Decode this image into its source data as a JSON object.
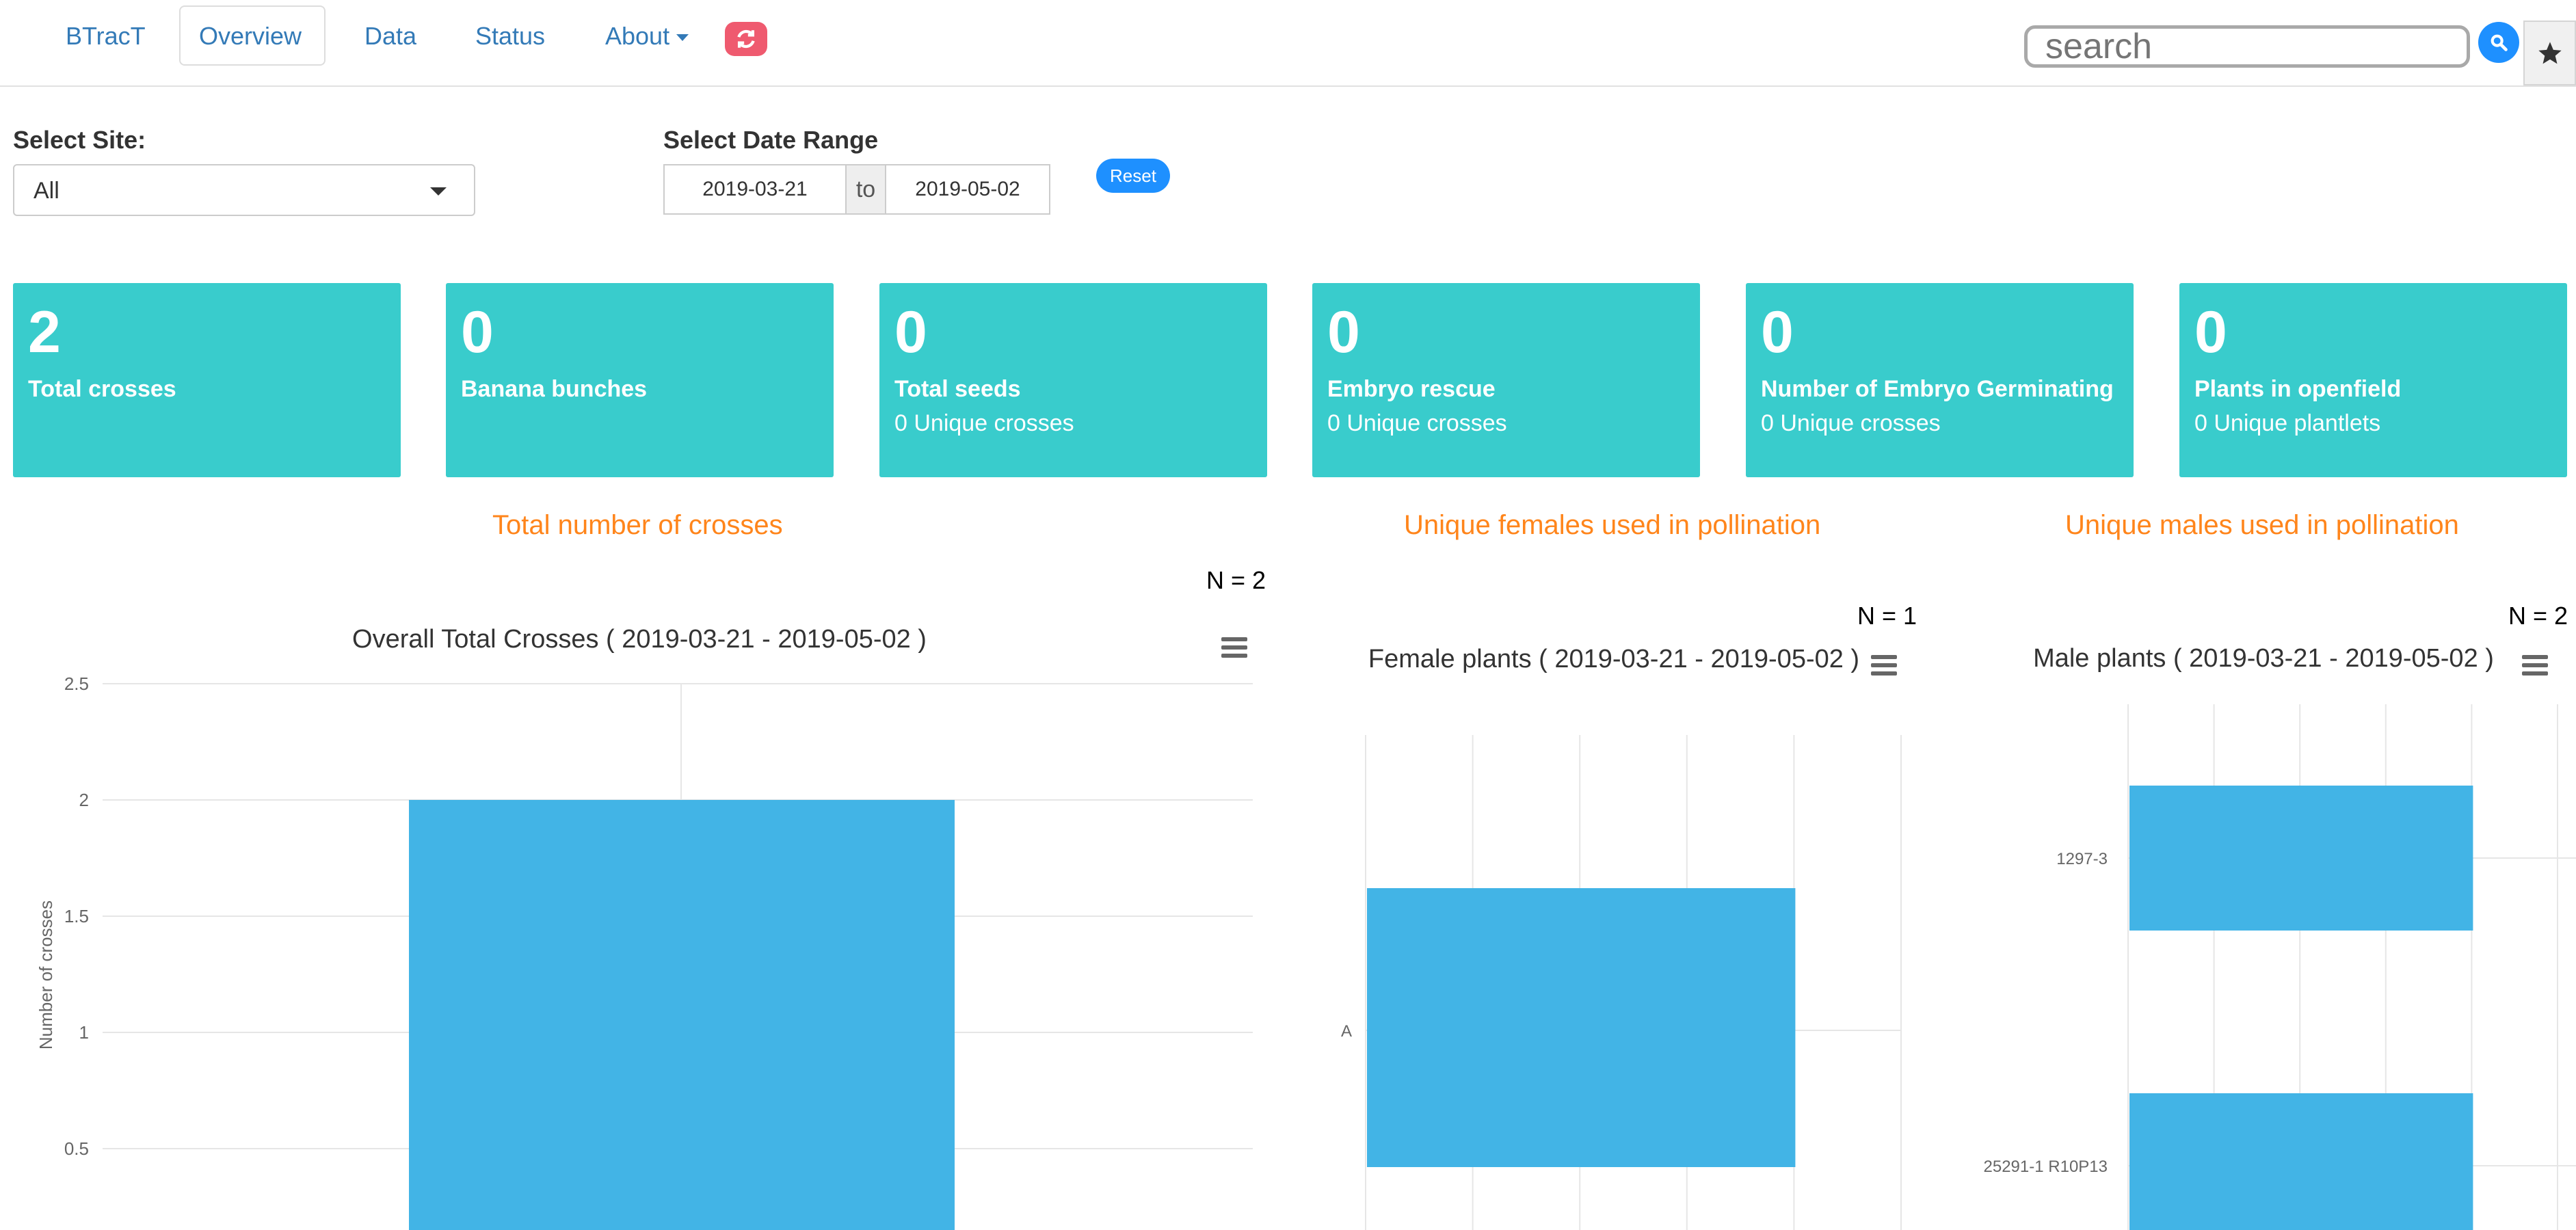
{
  "navbar": {
    "brand": "BTracT",
    "items": [
      "Overview",
      "Data",
      "Status",
      "About"
    ],
    "search": {
      "placeholder": "search"
    }
  },
  "filters": {
    "site_label": "Select Site:",
    "site_value": "All",
    "date_label": "Select Date Range",
    "date_from": "2019-03-21",
    "date_to_sep": "to",
    "date_to": "2019-05-02",
    "reset_label": "Reset"
  },
  "value_boxes": [
    {
      "value": "2",
      "label": "Total crosses",
      "sub": ""
    },
    {
      "value": "0",
      "label": "Banana bunches",
      "sub": ""
    },
    {
      "value": "0",
      "label": "Total seeds",
      "sub": "0 Unique crosses"
    },
    {
      "value": "0",
      "label": "Embryo rescue",
      "sub": "0 Unique crosses"
    },
    {
      "value": "0",
      "label": "Number of Embryo Germinating",
      "sub": "0 Unique crosses"
    },
    {
      "value": "0",
      "label": "Plants in openfield",
      "sub": "0 Unique plantlets"
    }
  ],
  "sections": {
    "crosses_title": "Total number of crosses",
    "females_title": "Unique females used in pollination",
    "males_title": "Unique males used in pollination",
    "crosses_n": "N = 2",
    "females_n": "N = 1",
    "males_n": "N = 2"
  },
  "colors": {
    "accent": "#39cccc",
    "bar": "#42b4e6",
    "section_title": "#ff851b",
    "link": "#337ab7"
  },
  "chart_data": [
    {
      "type": "bar",
      "title": "Overall Total Crosses ( 2019-03-21 - 2019-05-02 )",
      "ylabel": "Number of crosses",
      "yticks": [
        "2.5",
        "2",
        "1.5",
        "1",
        "0.5"
      ],
      "ylim": [
        0,
        2.5
      ],
      "values": [
        2
      ]
    },
    {
      "type": "bar",
      "orientation": "horizontal",
      "title": "Female plants ( 2019-03-21 - 2019-05-02 )",
      "categories": [
        "A"
      ],
      "values": [
        1
      ],
      "xlim": [
        0,
        1.25
      ]
    },
    {
      "type": "bar",
      "orientation": "horizontal",
      "title": "Male plants ( 2019-03-21 - 2019-05-02 )",
      "categories": [
        "1297-3",
        "25291-1 R10P13"
      ],
      "values": [
        1,
        1
      ],
      "xlim": [
        0,
        1.25
      ]
    }
  ]
}
